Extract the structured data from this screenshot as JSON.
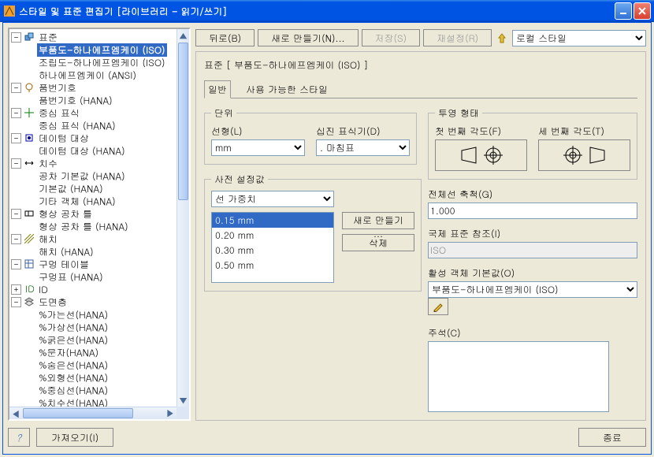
{
  "window": {
    "title": "스타일 및 표준 편집기 [라이브러리 - 읽기/쓰기]"
  },
  "toolbar": {
    "back": "뒤로(B)",
    "new": "새로 만들기(N)...",
    "save": "저장(S)",
    "reset": "재설정(R)",
    "scope_options": [
      "로컬 스타일"
    ],
    "scope_selected": "로컬 스타일"
  },
  "tree": {
    "root": "표준",
    "selected": "부품도-하나에프엠케이 (ISO)",
    "groups": [
      {
        "label": "표준",
        "icon": "cube-stack",
        "expand": "-",
        "children": [
          "부품도-하나에프엠케이 (ISO)",
          "조립도-하나에프엠케이 (ISO)",
          "하나에프엠케이 (ANSI)"
        ]
      },
      {
        "label": "품번기호",
        "icon": "balloon",
        "expand": "-",
        "children": [
          "품번기호 (HANA)"
        ]
      },
      {
        "label": "중심 표식",
        "icon": "center-mark",
        "expand": "-",
        "children": [
          "중심 표식 (HANA)"
        ]
      },
      {
        "label": "데이텀 대상",
        "icon": "datum",
        "expand": "-",
        "children": [
          "데이텀 대상 (HANA)"
        ]
      },
      {
        "label": "치수",
        "icon": "dimension",
        "expand": "-",
        "children": [
          "공차 기본값 (HANA)",
          "기본값 (HANA)",
          "기타 객체 (HANA)"
        ]
      },
      {
        "label": "형상 공차 틀",
        "icon": "fcf",
        "expand": "-",
        "children": [
          "형상 공차 틀 (HANA)"
        ]
      },
      {
        "label": "해치",
        "icon": "hatch",
        "expand": "-",
        "children": [
          "해치 (HANA)"
        ]
      },
      {
        "label": "구멍 테이블",
        "icon": "hole-table",
        "expand": "-",
        "children": [
          "구멍표 (HANA)"
        ]
      },
      {
        "label": "ID",
        "icon": "id",
        "expand": "+"
      },
      {
        "label": "도면층",
        "icon": "layers",
        "expand": "-",
        "children": [
          "%가는선(HANA)",
          "%가상선(HANA)",
          "%굵은선(HANA)",
          "%문자(HANA)",
          "%숨은선(HANA)",
          "%외형선(HANA)",
          "%중심선(HANA)",
          "%치수선(HANA)"
        ]
      }
    ]
  },
  "props": {
    "heading": "표준 [ 부품도-하나에프엠케이 (ISO) ]",
    "tabs": {
      "general": "일반",
      "available": "사용 가능한 스타일"
    },
    "unit_group": "단위",
    "linetype_label": "선형(L)",
    "linetype_value": "mm",
    "decimal_label": "십진 표식기(D)",
    "decimal_value": ". 마침표",
    "proj_group": "투영 형태",
    "first_angle": "첫 번째 각도(F)",
    "third_angle": "세 번째 각도(T)",
    "preset_group": "사전 설정값",
    "preset_select": "선 가중치",
    "preset_items": [
      "0.15 mm",
      "0.20 mm",
      "0.30 mm",
      "0.50 mm"
    ],
    "preset_selected": "0.15 mm",
    "preset_new_btn": "새로 만들기 ...",
    "preset_del_btn": "삭제",
    "scale_label": "전체선 축척(G)",
    "scale_value": "1.000",
    "intl_label": "국제 표준 참조(I)",
    "intl_value": "ISO",
    "active_label": "활성 객체 기본값(O)",
    "active_value": "부품도-하나에프엠케이 (ISO)",
    "comment_label": "주석(C)"
  },
  "bottom": {
    "import": "가져오기(I)",
    "done": "종료"
  }
}
